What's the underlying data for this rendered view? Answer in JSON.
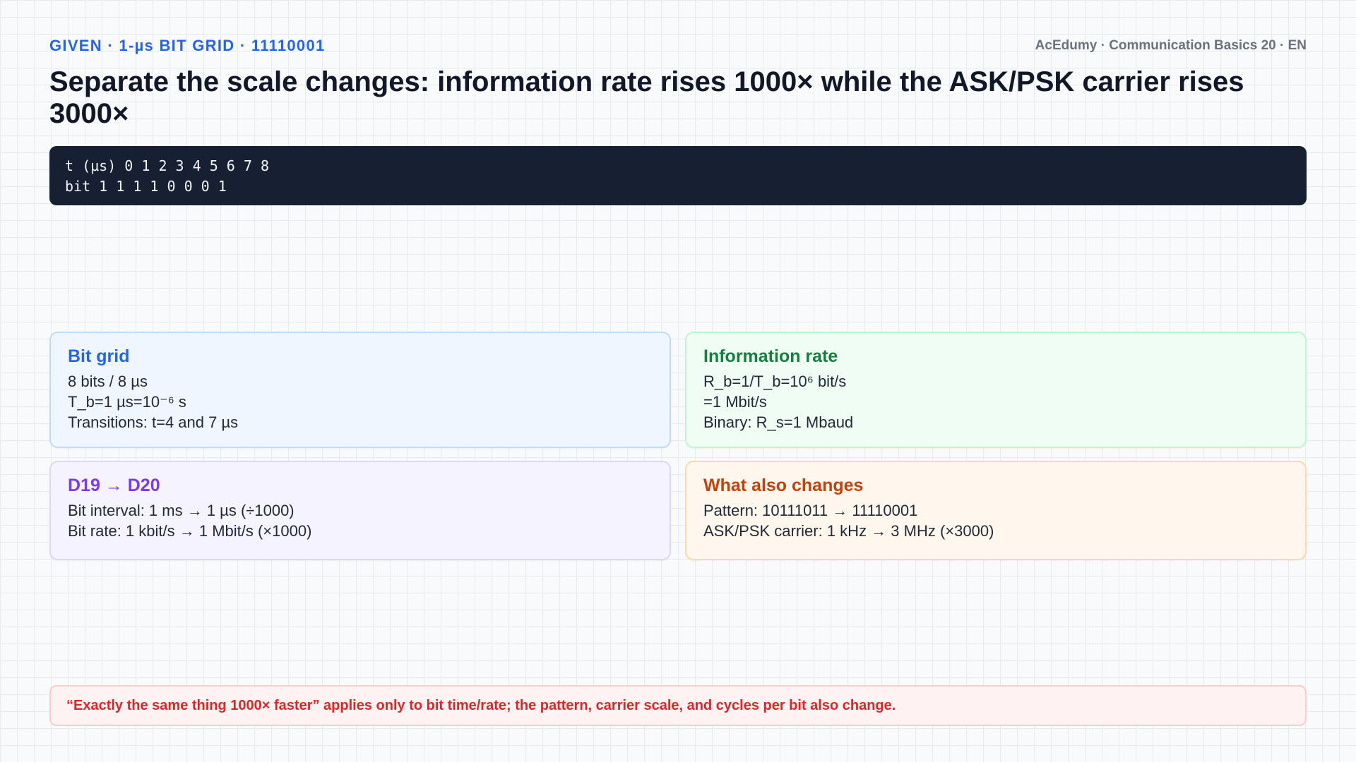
{
  "header": {
    "kicker": "GIVEN · 1-µs BIT GRID · 11110001",
    "brand": "AcEdumy · Communication Basics 20 · EN",
    "title": "Separate the scale changes: information rate rises 1000× while the ASK/PSK carrier rises 3000×"
  },
  "code_block": {
    "lines": [
      "t (µs) 0 1 2 3 4 5 6 7 8",
      "bit 1 1 1 1 0 0 0 1"
    ]
  },
  "cards": {
    "bit_grid": {
      "title": "Bit grid",
      "lines": [
        "8 bits / 8 µs",
        "T_b=1 µs=10⁻⁶ s",
        "Transitions: t=4 and 7 µs"
      ]
    },
    "information_rate": {
      "title": "Information rate",
      "lines": [
        "R_b=1/T_b=10⁶ bit/s",
        "=1 Mbit/s",
        "Binary: R_s=1 Mbaud"
      ]
    },
    "d19_d20": {
      "title": "D19 → D20",
      "lines": [
        "Bit interval: 1 ms → 1 µs (÷1000)",
        "Bit rate: 1 kbit/s → 1 Mbit/s (×1000)"
      ]
    },
    "what_also_changes": {
      "title": "What also changes",
      "lines": [
        "Pattern: 10111011 → 11110001",
        "ASK/PSK carrier: 1 kHz → 3 MHz (×3000)"
      ]
    }
  },
  "callout": {
    "text": "“Exactly the same thing 1000× faster” applies only to bit time/rate; the pattern, carrier scale, and cycles per bit also change."
  },
  "colors": {
    "accent_blue": "#2563eb",
    "accent_green": "#15803d",
    "accent_purple": "#7c3aed",
    "accent_orange": "#c2410c",
    "alert_red": "#dc2626",
    "code_background": "#172033"
  }
}
